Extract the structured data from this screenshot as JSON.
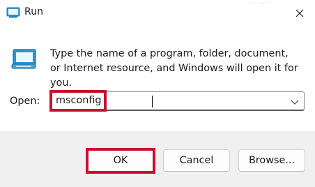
{
  "window": {
    "title": "Run",
    "close_icon": "close-icon",
    "faint_text": "· ·  ······"
  },
  "body": {
    "description": "Type the name of a program, folder, document, or Internet resource, and Windows will open it for you.",
    "open_label": "Open:",
    "open_value": "msconfig",
    "dropdown_icon": "chevron-down-icon"
  },
  "footer": {
    "ok_label": "OK",
    "cancel_label": "Cancel",
    "browse_label": "Browse..."
  },
  "colors": {
    "highlight": "#c8102e",
    "footer_bg": "#f0f0f0"
  }
}
